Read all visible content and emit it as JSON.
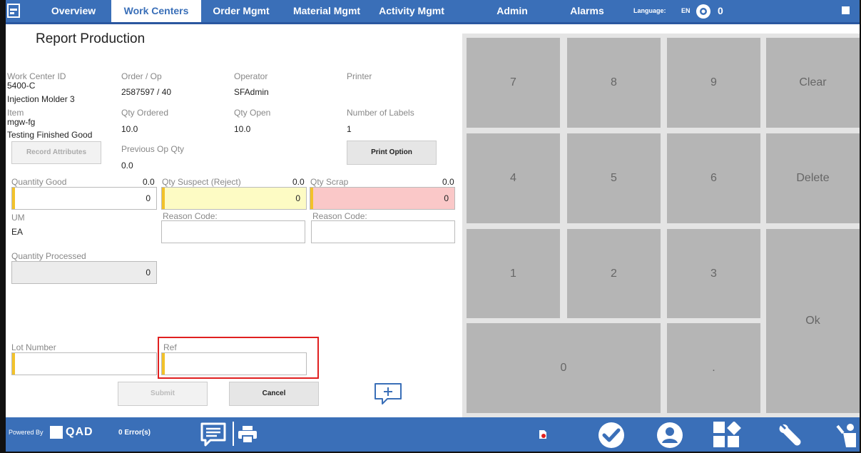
{
  "nav": {
    "tabs": [
      "Overview",
      "Work Centers",
      "Order Mgmt",
      "Material Mgmt",
      "Activity Mgmt",
      "Admin",
      "Alarms"
    ],
    "language_label": "Language:",
    "language_value": "EN",
    "alarm_count": "0",
    "brand_fragment": "QA"
  },
  "page": {
    "title": "Report Production"
  },
  "info": {
    "work_center_label": "Work Center ID",
    "work_center_id": "5400-C",
    "work_center_name": "Injection Molder 3",
    "order_label": "Order / Op",
    "order_value": "2587597 / 40",
    "operator_label": "Operator",
    "operator_value": "SFAdmin",
    "printer_label": "Printer",
    "item_label": "Item",
    "item_code": "mgw-fg",
    "item_desc": "Testing Finished Good",
    "qty_ordered_label": "Qty Ordered",
    "qty_ordered_value": "10.0",
    "qty_open_label": "Qty Open",
    "qty_open_value": "10.0",
    "labels_label": "Number of Labels",
    "labels_value": "1",
    "record_attributes": "Record Attributes",
    "prev_op_label": "Previous Op Qty",
    "prev_op_value": "0.0",
    "print_option": "Print Option"
  },
  "quantities": {
    "good_label": "Quantity Good",
    "good_total": "0.0",
    "good_value": "0",
    "suspect_label": "Qty Suspect (Reject)",
    "suspect_total": "0.0",
    "suspect_value": "0",
    "scrap_label": "Qty Scrap",
    "scrap_total": "0.0",
    "scrap_value": "0",
    "um_label": "UM",
    "um_value": "EA",
    "reason_label_1": "Reason Code:",
    "reason_label_2": "Reason Code:",
    "processed_label": "Quantity Processed",
    "processed_value": "0",
    "lot_label": "Lot Number",
    "ref_label": "Ref"
  },
  "actions": {
    "submit": "Submit",
    "cancel": "Cancel"
  },
  "keypad": {
    "k7": "7",
    "k8": "8",
    "k9": "9",
    "clear": "Clear",
    "k4": "4",
    "k5": "5",
    "k6": "6",
    "delete": "Delete",
    "k1": "1",
    "k2": "2",
    "k3": "3",
    "ok": "Ok",
    "k0": "0",
    "dot": "."
  },
  "footer": {
    "powered_by": "Powered By",
    "brand": "QAD",
    "errors": "0 Error(s)"
  },
  "colors": {
    "nav": "#3a6fb8",
    "highlight": "#e02020",
    "suspect": "#fdfbc4",
    "scrap": "#fac8c8",
    "required": "#f2c22a"
  }
}
